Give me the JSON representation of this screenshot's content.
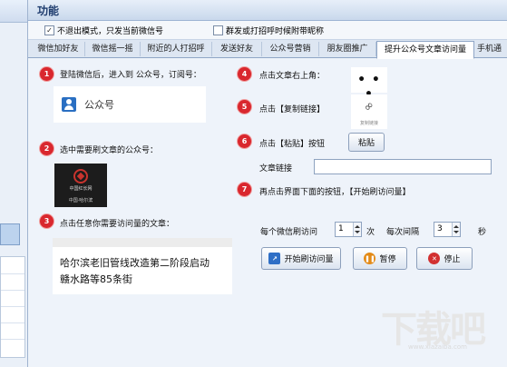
{
  "window": {
    "title": "功能"
  },
  "options": {
    "exit_mode_checked": true,
    "exit_mode_label": "不退出模式，只发当前微信号",
    "group_nickname_checked": false,
    "group_nickname_label": "群发或打招呼时候附带昵称"
  },
  "tabs": [
    {
      "label": "微信加好友"
    },
    {
      "label": "微信摇一摇"
    },
    {
      "label": "附近的人打招呼"
    },
    {
      "label": "发送好友"
    },
    {
      "label": "公众号营销"
    },
    {
      "label": "朋友圈推广"
    },
    {
      "label": "提升公众号文章访问量",
      "active": true
    },
    {
      "label": "手机通"
    }
  ],
  "steps": [
    {
      "num": "1",
      "text": "登陆微信后，进入到 公众号，订阅号："
    },
    {
      "num": "2",
      "text": "选中需要刷文章的公众号："
    },
    {
      "num": "3",
      "text": "点击任意你需要访问量的文章："
    },
    {
      "num": "4",
      "text": "点击文章右上角："
    },
    {
      "num": "5",
      "text": "点击【复制链接】"
    },
    {
      "num": "6",
      "text": "点击【粘贴】按钮"
    },
    {
      "num": "7",
      "text": "再点击界面下面的按钮，【开始刷访问量】"
    }
  ],
  "guide": {
    "public_account_label": "公众号",
    "logo_line1": "中国红长网",
    "logo_line2": "中国·哈尔滨",
    "article_line1": "哈尔滨老旧管线改造第二阶段启动",
    "article_line2": "赣水路等85条街",
    "more_dots": "• • •",
    "copy_link_caption": "复制链接"
  },
  "controls": {
    "paste_button": "粘贴",
    "link_label": "文章链接",
    "link_value": "",
    "per_account_label": "每个微信刷访问",
    "per_account_value": "1",
    "per_account_unit": "次",
    "interval_label": "每次间隔",
    "interval_value": "3",
    "interval_unit": "秒",
    "start_button": "开始刷访问量",
    "pause_button": "暂停",
    "stop_button": "停止"
  },
  "watermark": {
    "text": "下载吧",
    "url": "www.xiazaiba.com"
  },
  "colors": {
    "accent_red": "#d9272e",
    "tab_active_bg": "#ffffff",
    "panel_bg": "#eef3fa"
  }
}
